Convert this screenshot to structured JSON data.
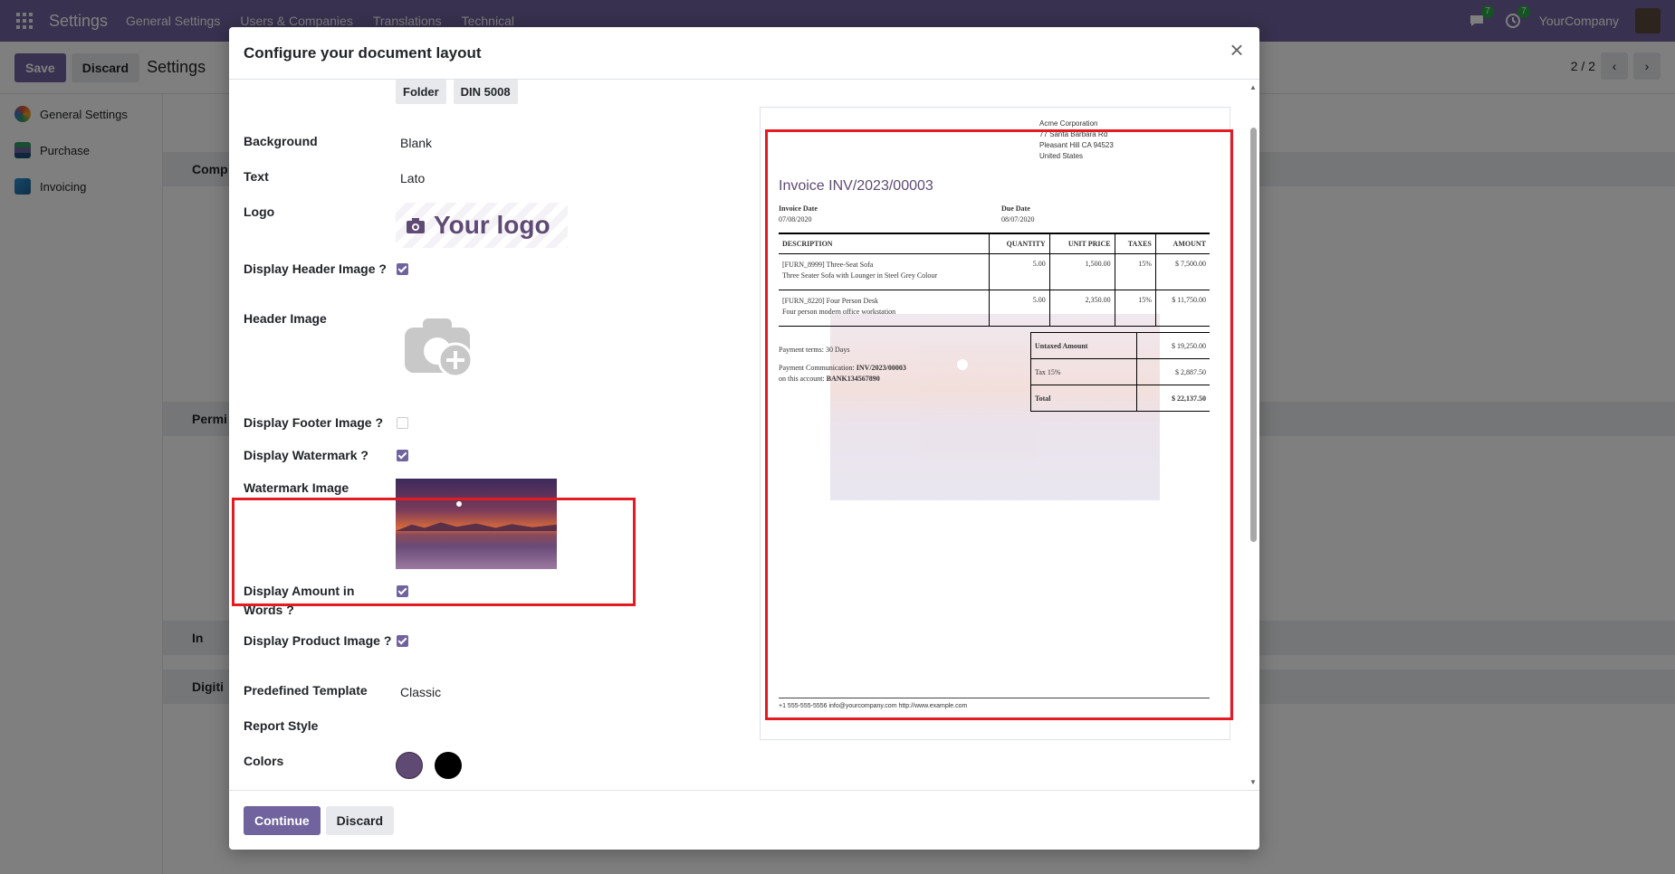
{
  "topbar": {
    "app_name": "Settings",
    "menu": [
      "General Settings",
      "Users & Companies",
      "Translations",
      "Technical"
    ],
    "messages_count": "7",
    "activities_count": "7",
    "company": "YourCompany"
  },
  "control": {
    "save_label": "Save",
    "discard_label": "Discard",
    "title": "Settings",
    "pager": "2 / 2"
  },
  "sidebar": {
    "items": [
      {
        "label": "General Settings",
        "icon": "settings-icon"
      },
      {
        "label": "Purchase",
        "icon": "purchase-icon"
      },
      {
        "label": "Invoicing",
        "icon": "invoicing-icon"
      }
    ]
  },
  "background_sections": [
    "Comp",
    "Permi",
    "In",
    "Digiti"
  ],
  "modal": {
    "title": "Configure your document layout",
    "form": {
      "layout_tags": [
        "Folder",
        "DIN 5008"
      ],
      "background_label": "Background",
      "background_value": "Blank",
      "text_label": "Text",
      "text_value": "Lato",
      "logo_label": "Logo",
      "logo_text": "Your logo",
      "display_header_image_label": "Display Header Image ?",
      "display_header_image": true,
      "header_image_label": "Header Image",
      "display_footer_image_label": "Display Footer Image ?",
      "display_footer_image": false,
      "display_watermark_label": "Display Watermark ?",
      "display_watermark": true,
      "watermark_image_label": "Watermark Image",
      "display_amount_words_label": "Display Amount in Words ?",
      "display_amount_words": true,
      "display_product_image_label": "Display Product Image ?",
      "display_product_image": true,
      "predefined_template_label": "Predefined Template",
      "predefined_template_value": "Classic",
      "report_style_label": "Report Style",
      "colors_label": "Colors",
      "colors": [
        "#5f4a73",
        "#000000"
      ]
    },
    "preview": {
      "company_name": "Acme Corporation",
      "address_1": "77 Santa Barbara Rd",
      "address_2": "Pleasant Hill CA 94523",
      "country": "United States",
      "invoice_title": "Invoice INV/2023/00003",
      "invoice_date_label": "Invoice Date",
      "invoice_date": "07/08/2020",
      "due_date_label": "Due Date",
      "due_date": "08/07/2020",
      "columns": [
        "DESCRIPTION",
        "QUANTITY",
        "UNIT PRICE",
        "TAXES",
        "AMOUNT"
      ],
      "lines": [
        {
          "desc1": "[FURN_8999] Three-Seat Sofa",
          "desc2": "Three Seater Sofa with Lounger in Steel Grey Colour",
          "qty": "5.00",
          "price": "1,500.00",
          "tax": "15%",
          "amount": "$ 7,500.00"
        },
        {
          "desc1": "[FURN_8220] Four Person Desk",
          "desc2": "Four person modern office workstation",
          "qty": "5.00",
          "price": "2,350.00",
          "tax": "15%",
          "amount": "$ 11,750.00"
        }
      ],
      "payment_terms": "Payment terms: 30 Days",
      "payment_comm_label": "Payment Communication:",
      "payment_comm": "INV/2023/00003",
      "account_label": "on this account:",
      "account": "BANK134567890",
      "untaxed_label": "Untaxed Amount",
      "untaxed": "$ 19,250.00",
      "tax_label": "Tax 15%",
      "tax": "$ 2,887.50",
      "total_label": "Total",
      "total": "$ 22,137.50",
      "footer": "+1 555-555-5556 info@yourcompany.com http://www.example.com"
    },
    "continue_label": "Continue",
    "discard_label": "Discard"
  }
}
